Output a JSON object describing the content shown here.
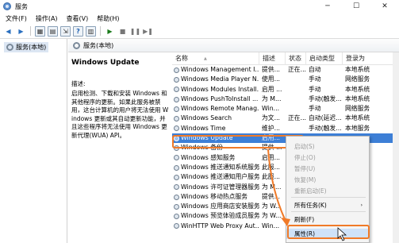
{
  "window": {
    "title": "服务",
    "minimize": "─",
    "maximize": "☐",
    "close": "✕"
  },
  "menu": [
    "文件(F)",
    "操作(A)",
    "查看(V)",
    "帮助(H)"
  ],
  "tree": {
    "root_label": "服务(本地)"
  },
  "header": {
    "label": "服务(本地)"
  },
  "description": {
    "service_name": "Windows Update",
    "label": "描述:",
    "text": "启用检测、下载和安装 Windows 和其他程序的更新。如果此服务被禁用，这台计算机的用户将无法使用 Windows 更新或其自动更新功能，并且这些程序将无法使用 Windows 更新代理(WUA) API。"
  },
  "table": {
    "headers": {
      "name": "名称",
      "desc": "描述",
      "status": "状态",
      "startup": "启动类型",
      "logon": "登录为"
    },
    "rows": [
      {
        "name": "Windows Management I...",
        "desc": "提供...",
        "status": "正在...",
        "startup": "自动",
        "logon": "本地系统"
      },
      {
        "name": "Windows Media Player N...",
        "desc": "使用...",
        "status": "",
        "startup": "手动",
        "logon": "网络服务"
      },
      {
        "name": "Windows Modules Install...",
        "desc": "启用 ...",
        "status": "",
        "startup": "手动",
        "logon": "本地系统"
      },
      {
        "name": "Windows PushToInstall ...",
        "desc": "为 M...",
        "status": "",
        "startup": "手动(触发...",
        "logon": "本地系统"
      },
      {
        "name": "Windows Remote Manag...",
        "desc": "Win...",
        "status": "",
        "startup": "手动",
        "logon": "网络服务"
      },
      {
        "name": "Windows Search",
        "desc": "为文...",
        "status": "正在...",
        "startup": "自动(延迟...",
        "logon": "本地系统"
      },
      {
        "name": "Windows Time",
        "desc": "维护...",
        "status": "",
        "startup": "手动(触发...",
        "logon": "本地服务"
      },
      {
        "name": "Windows Update",
        "desc": "启用...",
        "status": "",
        "startup": "",
        "logon": ""
      },
      {
        "name": "Windows 备份",
        "desc": "提供 ...",
        "status": "",
        "startup": "",
        "logon": ""
      },
      {
        "name": "Windows 感知服务",
        "desc": "启用...",
        "status": "",
        "startup": "",
        "logon": ""
      },
      {
        "name": "Windows 推送通知系统服务",
        "desc": "此服...",
        "status": "",
        "startup": "",
        "logon": ""
      },
      {
        "name": "Windows 推送通知用户服务...",
        "desc": "此服...",
        "status": "",
        "startup": "",
        "logon": ""
      },
      {
        "name": "Windows 许可证管理器服务",
        "desc": "为 M...",
        "status": "",
        "startup": "",
        "logon": ""
      },
      {
        "name": "Windows 移动热点服务",
        "desc": "提供...",
        "status": "",
        "startup": "",
        "logon": ""
      },
      {
        "name": "Windows 应用商店安装服务",
        "desc": "为 W...",
        "status": "",
        "startup": "",
        "logon": ""
      },
      {
        "name": "Windows 预览体验成员服务",
        "desc": "为 W...",
        "status": "",
        "startup": "",
        "logon": ""
      },
      {
        "name": "WinHTTP Web Proxy Aut...",
        "desc": "Win...",
        "status": "",
        "startup": "",
        "logon": ""
      }
    ]
  },
  "context_menu": {
    "items": [
      {
        "label": "启动(S)",
        "enabled": false
      },
      {
        "label": "停止(O)",
        "enabled": false
      },
      {
        "label": "暂停(U)",
        "enabled": false
      },
      {
        "label": "恢复(M)",
        "enabled": false
      },
      {
        "label": "重新启动(E)",
        "enabled": false
      },
      {
        "label": "所有任务(K)",
        "enabled": true,
        "submenu_arrow": "›"
      },
      {
        "label": "刷新(F)",
        "enabled": true
      },
      {
        "label": "属性(R)",
        "enabled": true
      }
    ]
  },
  "colors": {
    "highlight": "#f07a28",
    "selection": "#3d7fd6"
  },
  "icons": [
    "back-arrow-icon",
    "forward-arrow-icon",
    "console-icon",
    "list-icon",
    "export-icon",
    "help-icon",
    "properties-icon",
    "play-icon",
    "stop-icon",
    "pause-icon",
    "restart-icon",
    "gear-icon",
    "cursor-icon"
  ]
}
